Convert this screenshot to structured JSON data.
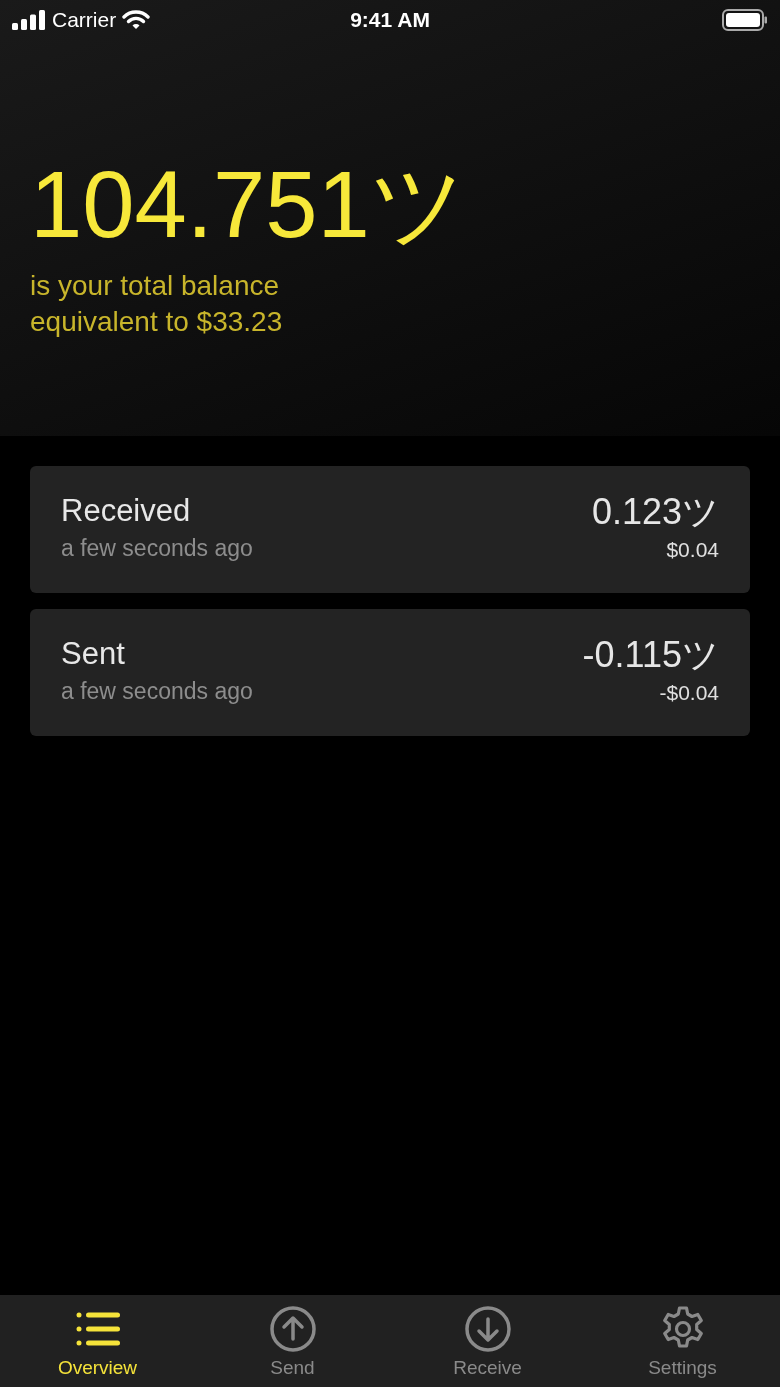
{
  "status_bar": {
    "carrier": "Carrier",
    "time": "9:41 AM"
  },
  "balance": {
    "amount": "104.751ツ",
    "caption": "is your total balance",
    "equivalent": "equivalent to $33.23"
  },
  "transactions": [
    {
      "title": "Received",
      "time": "a few seconds ago",
      "amount": "0.123ツ",
      "fiat": "$0.04"
    },
    {
      "title": "Sent",
      "time": "a few seconds ago",
      "amount": "-0.115ツ",
      "fiat": "-$0.04"
    }
  ],
  "tabs": [
    {
      "label": "Overview",
      "kind": "list",
      "selected": true
    },
    {
      "label": "Send",
      "kind": "up",
      "selected": false
    },
    {
      "label": "Receive",
      "kind": "down",
      "selected": false
    },
    {
      "label": "Settings",
      "kind": "gear",
      "selected": false
    }
  ]
}
